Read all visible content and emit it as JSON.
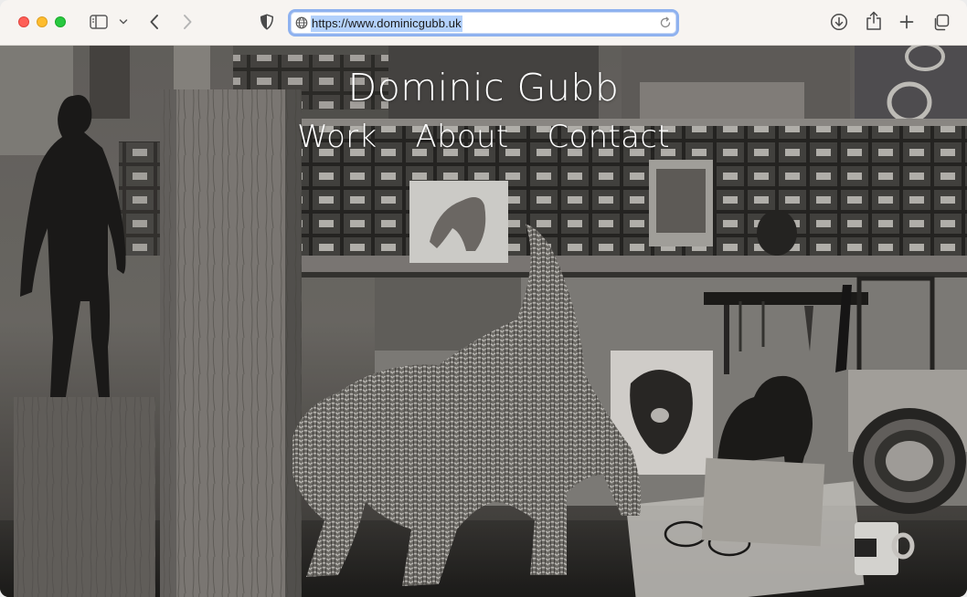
{
  "browser": {
    "url": "https://www.dominicgubb.uk",
    "icons": {
      "sidebar": "sidebar-icon",
      "chevron": "chevron-down-icon",
      "back": "back-arrow-icon",
      "forward": "forward-arrow-icon",
      "shield": "privacy-shield-icon",
      "globe": "globe-icon",
      "reload": "reload-icon",
      "download": "download-icon",
      "share": "share-icon",
      "new_tab": "plus-icon",
      "tabs": "tab-overview-icon"
    }
  },
  "site": {
    "title": "Dominic Gubb",
    "nav": [
      {
        "label": "Work"
      },
      {
        "label": "About"
      },
      {
        "label": "Contact"
      }
    ]
  },
  "colors": {
    "text": "#ffffff",
    "address_highlight": "#b3d1fb",
    "address_border": "#8fb2ef"
  }
}
